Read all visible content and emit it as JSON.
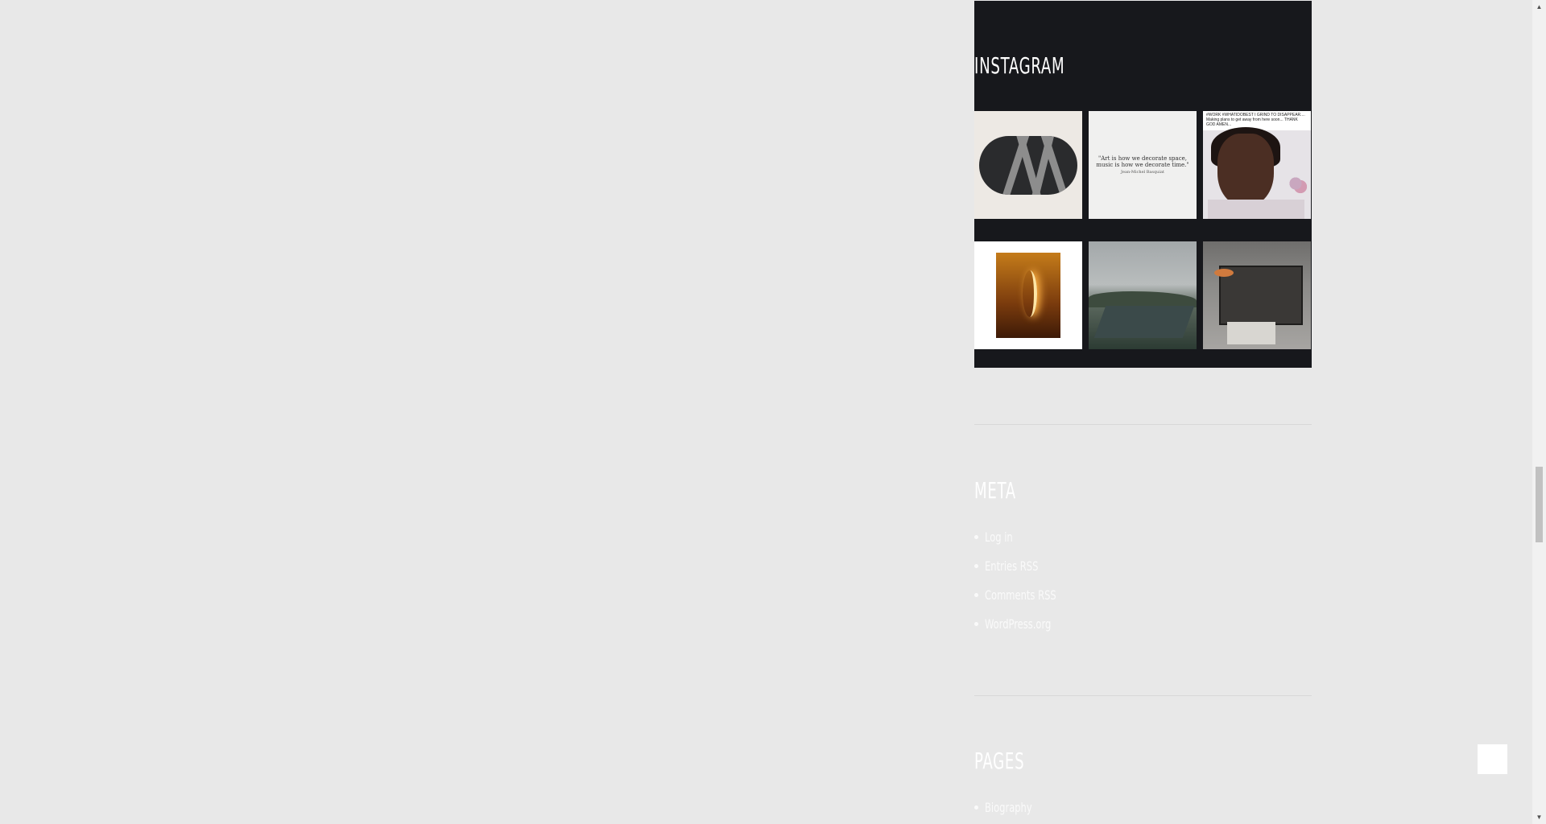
{
  "instagram": {
    "title": "INSTAGRAM",
    "posts": [
      {
        "caption": ""
      },
      {
        "quote_line1": "\"Art is how we decorate space,",
        "quote_line2": "music is how we decorate time.\"",
        "quote_author": "Jean-Michel Basquiat"
      },
      {
        "caption": "#WORK #WHATIDOBEST I GRIND TO DISAPPEAR.... Making plans to get away from here soon... THANK GOD AMEN..."
      },
      {
        "caption": ""
      },
      {
        "caption": ""
      },
      {
        "caption": ""
      }
    ]
  },
  "meta": {
    "title": "META",
    "links": [
      {
        "label": "Log in"
      },
      {
        "label": "Entries RSS"
      },
      {
        "label": "Comments RSS"
      },
      {
        "label": "WordPress.org"
      }
    ]
  },
  "pages": {
    "title": "PAGES",
    "links": [
      {
        "label": "Biography"
      }
    ]
  },
  "colors": {
    "background": "#e8e8e8",
    "widget_dark": "#17181c",
    "text_light": "#fafafa"
  },
  "icons": {
    "scroll_up": "triangle-up-icon",
    "scroll_down": "triangle-down-icon"
  }
}
